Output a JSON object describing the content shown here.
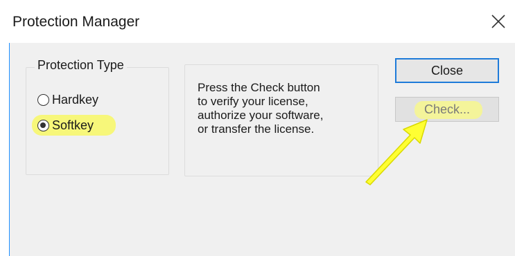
{
  "window": {
    "title": "Protection Manager"
  },
  "protection_type": {
    "legend": "Protection Type",
    "options": [
      {
        "label": "Hardkey",
        "selected": false
      },
      {
        "label": "Softkey",
        "selected": true
      }
    ]
  },
  "info": {
    "lines": [
      "Press the Check button",
      "to verify your license,",
      "authorize your software,",
      "or transfer the license."
    ]
  },
  "buttons": {
    "close_label": "Close",
    "check_label": "Check..."
  },
  "colors": {
    "focus_border": "#1e7bd9",
    "highlight": "#f7f77a",
    "arrow": "#ffff33"
  },
  "icons": {
    "window_close": "close-icon",
    "annotation": "arrow-icon"
  }
}
